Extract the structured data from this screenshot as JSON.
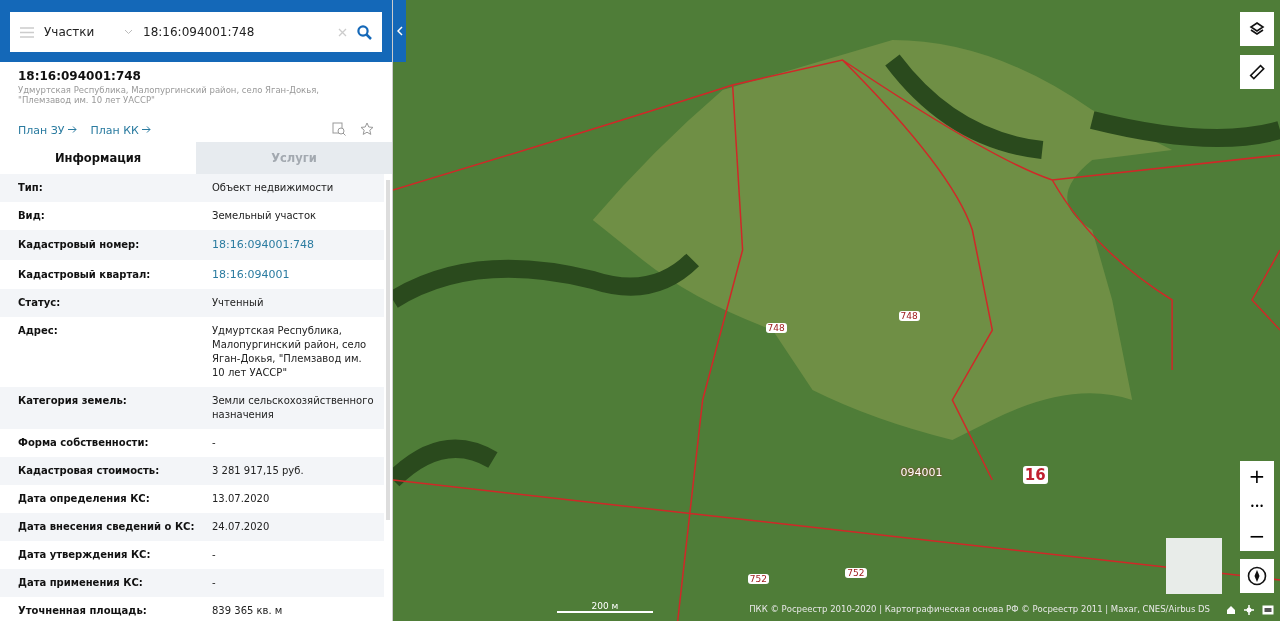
{
  "search": {
    "layer": "Участки",
    "value": "18:16:094001:748"
  },
  "object": {
    "title": "18:16:094001:748",
    "address": "Удмуртская Республика, Малопургинский район, село Яган-Докья, \"Племзавод им. 10 лет УАССР\"",
    "links": [
      "План ЗУ",
      "План КК"
    ]
  },
  "tabs": [
    {
      "label": "Информация",
      "selected": true
    },
    {
      "label": "Услуги",
      "selected": false
    }
  ],
  "rows": [
    {
      "label": "Тип:",
      "value": "Объект недвижимости",
      "kind": "text"
    },
    {
      "label": "Вид:",
      "value": "Земельный участок",
      "kind": "text"
    },
    {
      "label": "Кадастровый номер:",
      "value": "18:16:094001:748",
      "kind": "link"
    },
    {
      "label": "Кадастровый квартал:",
      "value": "18:16:094001",
      "kind": "link"
    },
    {
      "label": "Статус:",
      "value": "Учтенный",
      "kind": "text"
    },
    {
      "label": "Адрес:",
      "value": "Удмуртская Республика, Малопургинский район, село Яган-Докья, \"Племзавод им. 10 лет УАССР\"",
      "kind": "text"
    },
    {
      "label": "Категория земель:",
      "value": "Земли сельскохозяйственного назначения",
      "kind": "text"
    },
    {
      "label": "Форма собственности:",
      "value": "-",
      "kind": "text"
    },
    {
      "label": "Кадастровая стоимость:",
      "value": "3 281 917,15 руб.",
      "kind": "text"
    },
    {
      "label": "Дата определения КС:",
      "value": "13.07.2020",
      "kind": "text"
    },
    {
      "label": "Дата внесения сведений о КС:",
      "value": "24.07.2020",
      "kind": "text"
    },
    {
      "label": "Дата утверждения КС:",
      "value": "-",
      "kind": "text"
    },
    {
      "label": "Дата применения КС:",
      "value": "-",
      "kind": "text"
    },
    {
      "label": "Уточненная площадь:",
      "value": "839 365 кв. м",
      "kind": "text"
    }
  ],
  "map": {
    "labels": [
      {
        "text": "748",
        "kind": "parcel"
      },
      {
        "text": "748",
        "kind": "parcel"
      },
      {
        "text": "094001",
        "kind": "quarter"
      },
      {
        "text": "16",
        "kind": "district"
      },
      {
        "text": "752",
        "kind": "parcel"
      },
      {
        "text": "752",
        "kind": "parcel"
      }
    ],
    "zoom": {
      "in": "+",
      "more": "•••",
      "out": "−"
    },
    "scale": "200 м",
    "attribution": "ПКК © Росреестр 2010-2020 | Картографическая основа РФ © Росреестр 2011 | Maxar, CNES/Airbus DS"
  }
}
